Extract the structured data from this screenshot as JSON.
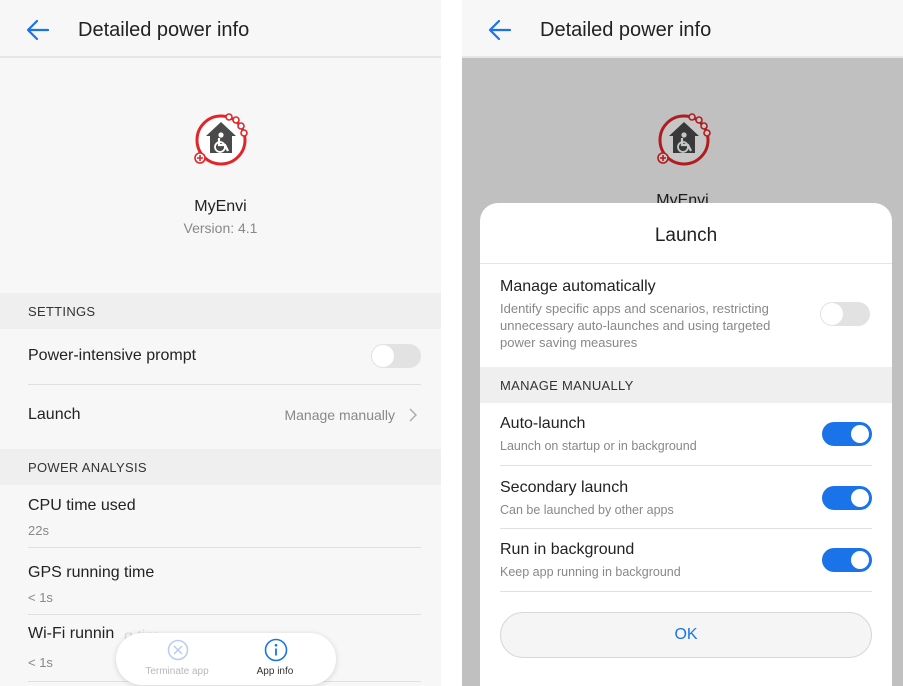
{
  "left": {
    "header": {
      "title": "Detailed power info"
    },
    "app": {
      "name": "MyEnvi",
      "version": "Version: 4.1"
    },
    "settings": {
      "header": "SETTINGS",
      "power_prompt": {
        "label": "Power-intensive prompt",
        "enabled": false
      },
      "launch": {
        "label": "Launch",
        "value": "Manage manually"
      }
    },
    "power_analysis": {
      "header": "POWER ANALYSIS",
      "items": [
        {
          "label": "CPU time used",
          "value": "22s"
        },
        {
          "label": "GPS running time",
          "value": "< 1s"
        },
        {
          "label": "Wi-Fi runnin",
          "value": "< 1s"
        }
      ],
      "obscured_fragment": "g tim"
    },
    "bottom_bar": {
      "terminate_label": "Terminate app",
      "info_label": "App info"
    }
  },
  "right": {
    "header": {
      "title": "Detailed power info"
    },
    "app": {
      "name_partial": "MyEnvi"
    },
    "dialog": {
      "title": "Launch",
      "auto": {
        "label": "Manage automatically",
        "description": "Identify specific apps and scenarios, restricting unnecessary auto-launches and using targeted power saving measures",
        "enabled": false
      },
      "manual_header": "MANAGE MANUALLY",
      "items": [
        {
          "label": "Auto-launch",
          "description": "Launch on startup or in background",
          "enabled": true
        },
        {
          "label": "Secondary launch",
          "description": "Can be launched by other apps",
          "enabled": true
        },
        {
          "label": "Run in background",
          "description": "Keep app running in background",
          "enabled": true
        }
      ],
      "ok_label": "OK"
    }
  },
  "colors": {
    "accent": "#1a73e8",
    "toggle_off": "#e2e2e2",
    "logo_red": "#e0262a"
  },
  "icons": [
    "back-arrow-icon",
    "app-logo-icon",
    "chevron-right-icon",
    "close-circle-icon",
    "info-icon"
  ]
}
